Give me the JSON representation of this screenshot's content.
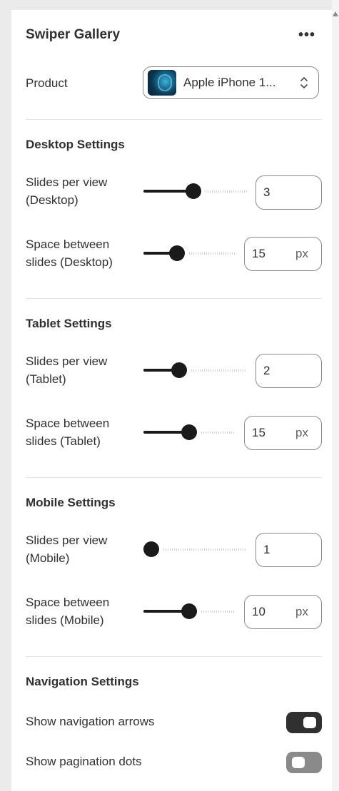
{
  "header": {
    "title": "Swiper Gallery",
    "more_label": "•••"
  },
  "product": {
    "label": "Product",
    "selected": "Apple iPhone 1..."
  },
  "desktop": {
    "title": "Desktop Settings",
    "slides_label": "Slides per view (Desktop)",
    "slides_value": "3",
    "slides_fraction": 0.48,
    "space_label": "Space between slides (Desktop)",
    "space_value": "15",
    "space_unit": "px",
    "space_fraction": 0.34
  },
  "tablet": {
    "title": "Tablet Settings",
    "slides_label": "Slides per view (Tablet)",
    "slides_value": "2",
    "slides_fraction": 0.32,
    "space_label": "Space between slides (Tablet)",
    "space_value": "15",
    "space_unit": "px",
    "space_fraction": 0.5
  },
  "mobile": {
    "title": "Mobile Settings",
    "slides_label": "Slides per view (Mobile)",
    "slides_value": "1",
    "slides_fraction": 0.0,
    "space_label": "Space between slides (Mobile)",
    "space_value": "10",
    "space_unit": "px",
    "space_fraction": 0.5
  },
  "navigation": {
    "title": "Navigation Settings",
    "arrows_label": "Show navigation arrows",
    "arrows_on": true,
    "dots_label": "Show pagination dots",
    "dots_on": false
  },
  "icons": {
    "more": "more-horizontal-icon",
    "select": "chevron-up-down-icon",
    "thumbnail": "product-thumbnail"
  }
}
